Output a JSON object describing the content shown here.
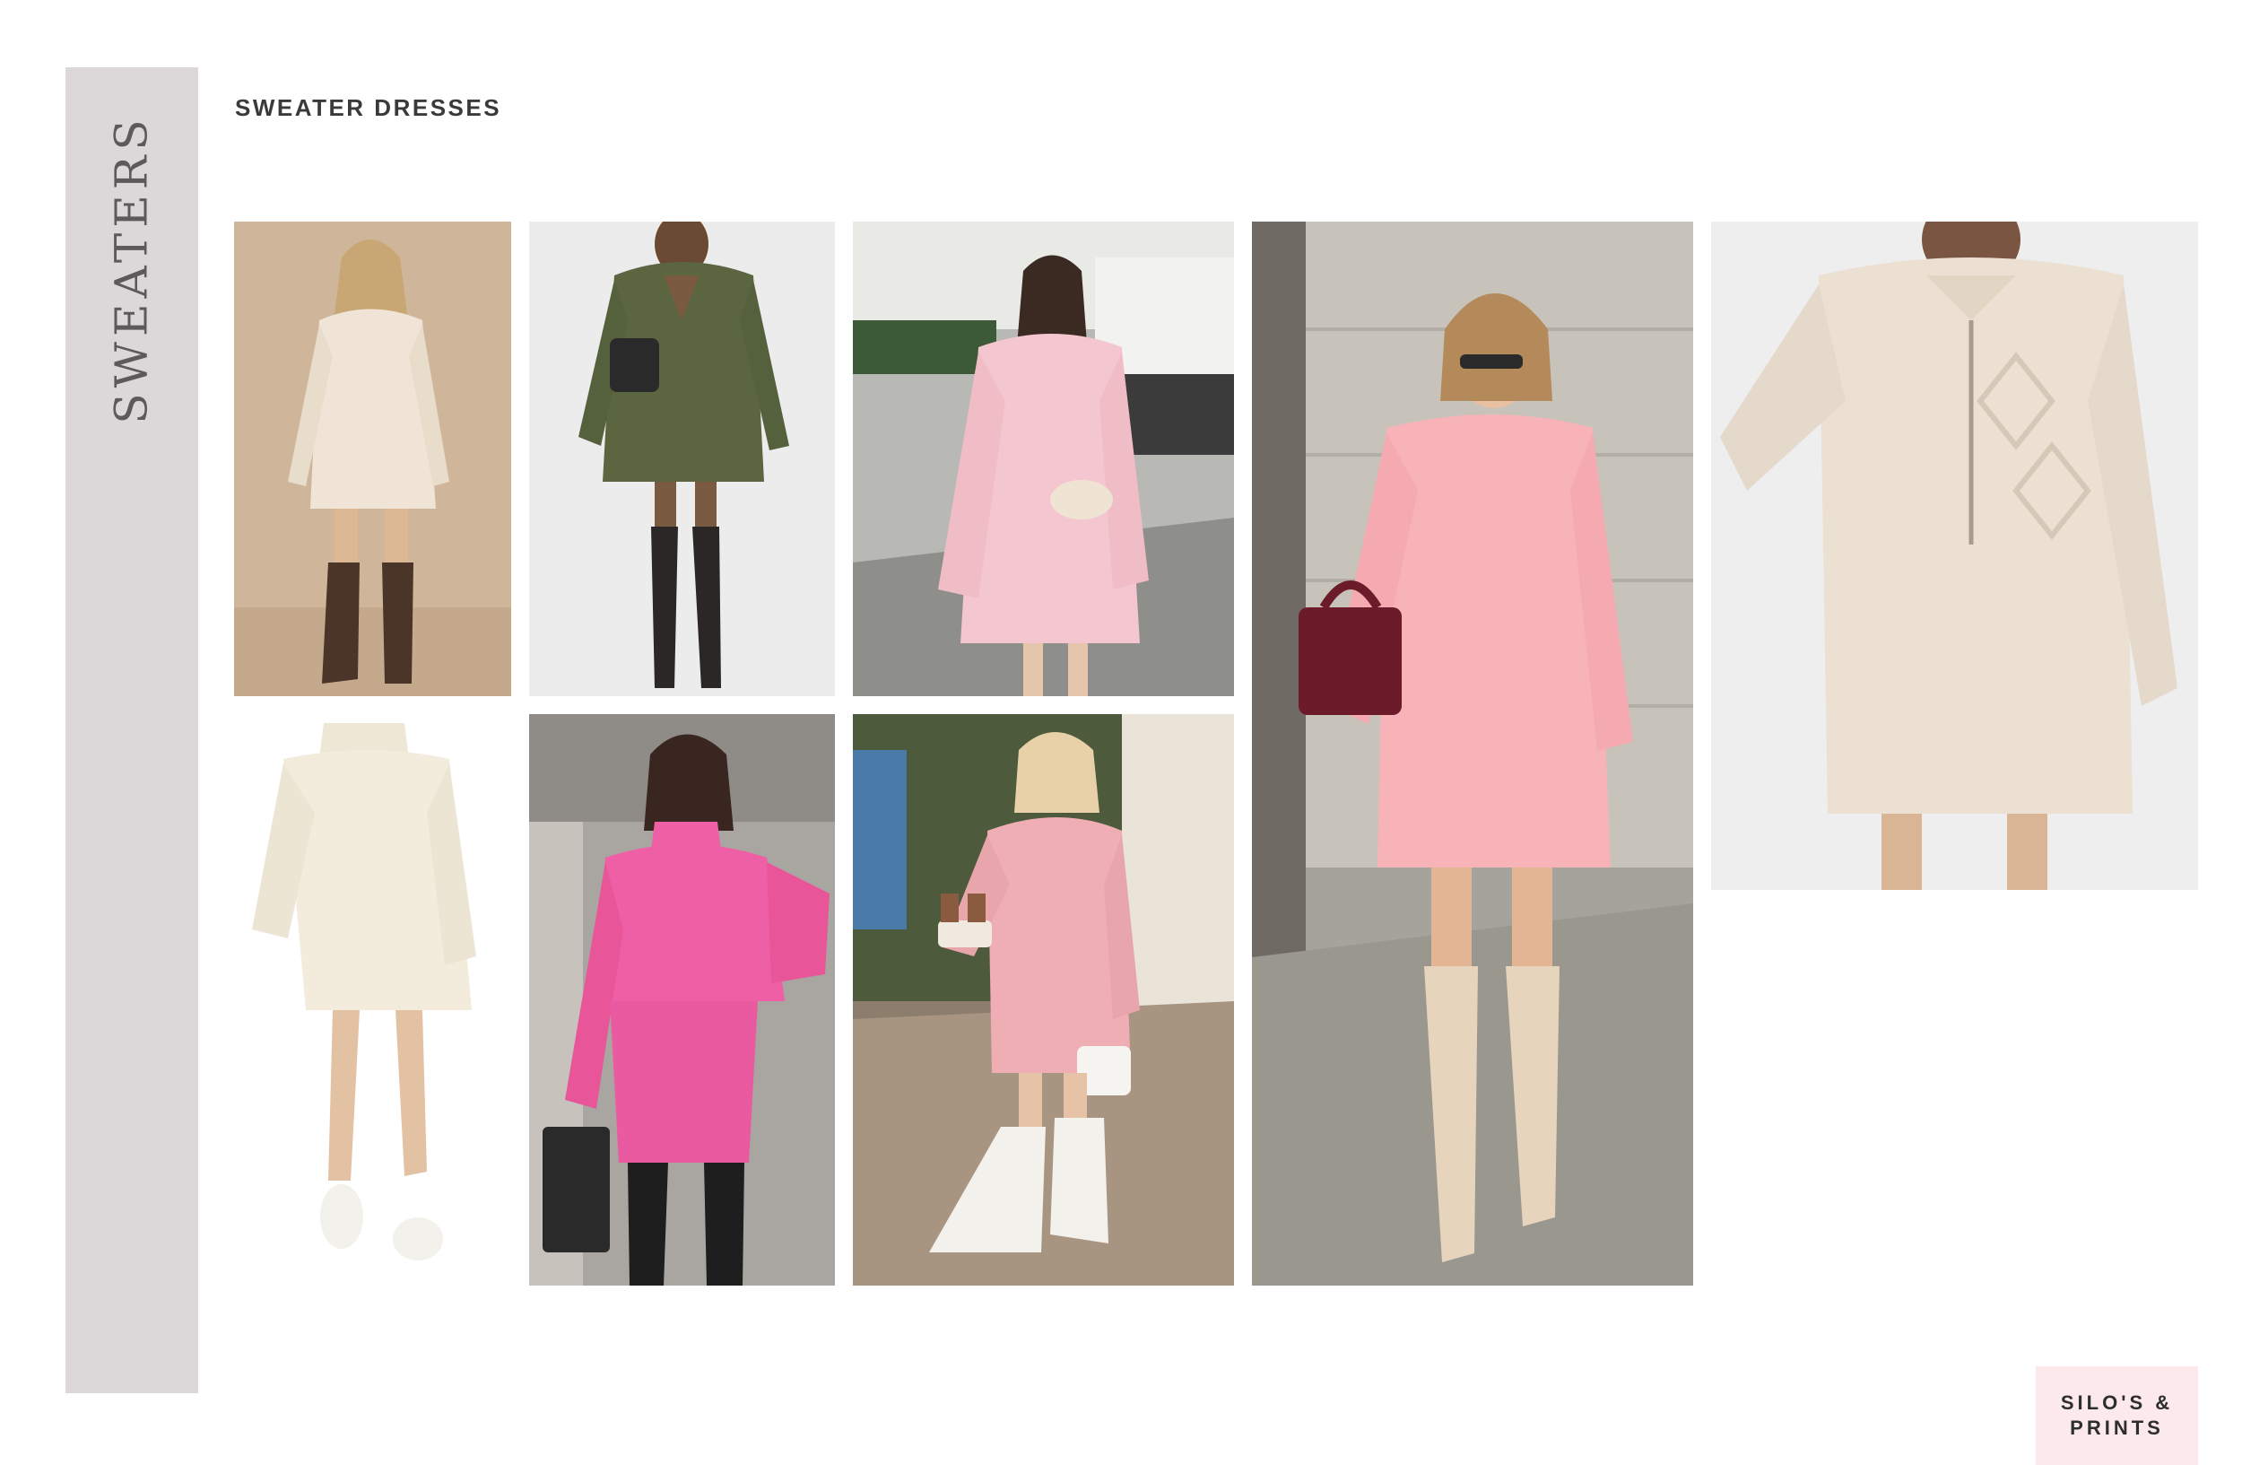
{
  "sidebar": {
    "title": "SWEATERS"
  },
  "section": {
    "title": "SWEATER DRESSES"
  },
  "gallery": {
    "items": [
      {
        "icon": "sweater-dress-photo",
        "dress_color": "#efe4d6",
        "background": "#cfb69a"
      },
      {
        "icon": "sweater-dress-photo",
        "dress_color": "#5b6540",
        "background": "#ececec"
      },
      {
        "icon": "sweater-dress-photo",
        "dress_color": "#f4c6cf",
        "background": "#b8b8b4"
      },
      {
        "icon": "sweater-dress-photo",
        "dress_color": "#f7b3b8",
        "background": "#a6a39c"
      },
      {
        "icon": "sweater-dress-photo",
        "dress_color": "#ebe0d2",
        "background": "#eeeeee"
      },
      {
        "icon": "sweater-dress-photo",
        "dress_color": "#f3ecdc",
        "background": "#ffffff"
      },
      {
        "icon": "sweater-dress-photo",
        "dress_color": "#ee5fa5",
        "background": "#a9a6a1"
      },
      {
        "icon": "sweater-dress-photo",
        "dress_color": "#eeaeb4",
        "background": "#8d7d6c"
      }
    ]
  },
  "logo": {
    "line1": "SILO'S &",
    "line2": "PRINTS",
    "background": "#fbe9ec"
  },
  "colors": {
    "side_band": "#dcd7d8",
    "side_text": "#5e5a5c",
    "heading_text": "#3a3a3a"
  }
}
